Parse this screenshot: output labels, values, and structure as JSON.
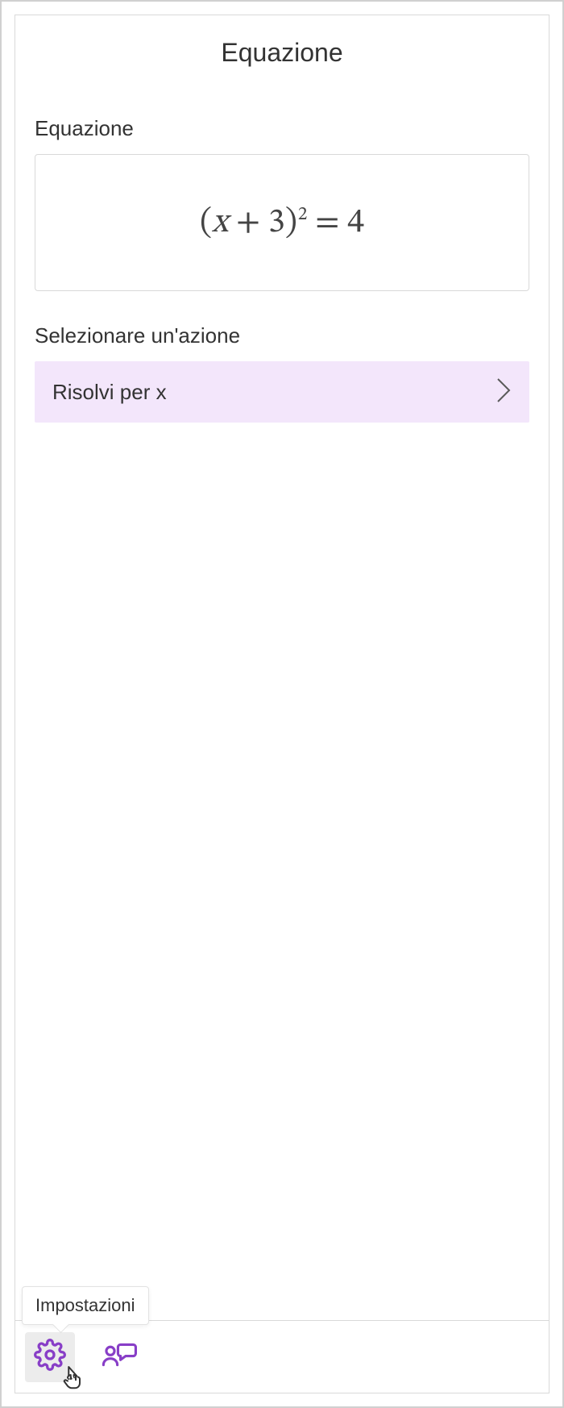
{
  "panel": {
    "title": "Equazione",
    "equation_label": "Equazione",
    "equation_display": "(x + 3)² = 4",
    "action_label": "Selezionare un'azione",
    "actions": [
      {
        "label": "Risolvi per x"
      }
    ]
  },
  "footer": {
    "settings_tooltip": "Impostazioni",
    "icons": {
      "settings": "gear-icon",
      "feedback": "people-chat-icon"
    }
  }
}
